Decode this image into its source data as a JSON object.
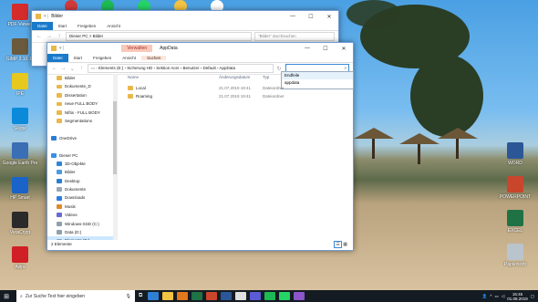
{
  "desktop": {
    "left_icons": [
      {
        "label": "PDF-Viewer",
        "color": "#d42b2b"
      },
      {
        "label": "GIMP 2.10.12",
        "color": "#6b5a3c"
      },
      {
        "label": "IPE",
        "color": "#e6c81e"
      },
      {
        "label": "Skype",
        "color": "#0b8ad9"
      },
      {
        "label": "Google Earth Pro",
        "color": "#3a6fb5"
      },
      {
        "label": "HP Smart",
        "color": "#1a63c8"
      },
      {
        "label": "VeraCrypt",
        "color": "#2a2a2a"
      },
      {
        "label": "Avira",
        "color": "#d11f26"
      }
    ],
    "right_icons": [
      {
        "label": "WORD",
        "color": "#2b5797"
      },
      {
        "label": "POWERPOINT",
        "color": "#c9462c"
      },
      {
        "label": "EXCEL",
        "color": "#1f7244"
      },
      {
        "label": "Papierkorb",
        "color": "#b9c4cc"
      }
    ],
    "top_icons": [
      {
        "color": "#d13b3b"
      },
      {
        "color": "#1db954"
      },
      {
        "color": "#25d366"
      },
      {
        "color": "#f3c342"
      },
      {
        "color": "#ffffff"
      }
    ]
  },
  "back_window": {
    "title": "Bilder",
    "tabs": [
      "Datei",
      "Start",
      "Freigeben",
      "Ansicht"
    ],
    "address": "Dieser PC  >  Bilder",
    "search_placeholder": "\"Bilder\" durchsuchen"
  },
  "front_window": {
    "title": "AppData",
    "context_tab": "Verwalten",
    "tabs": [
      "Datei",
      "Start",
      "Freigeben",
      "Ansicht",
      "Suchen"
    ],
    "address_parts": [
      "Elements (E:)",
      "Sicherung HD",
      "Sektion Acer",
      "Benutzer",
      "Default",
      "AppData"
    ],
    "search_value": "",
    "search_suggestions": [
      "Endfeile",
      "appdata"
    ],
    "columns": [
      "Name",
      "Änderungsdatum",
      "Typ"
    ],
    "files": [
      {
        "name": "Local",
        "date": "21.07.2019 19:41",
        "type": "Dateiordner"
      },
      {
        "name": "Roaming",
        "date": "21.07.2019 19:41",
        "type": "Dateiordner"
      }
    ],
    "nav_tree": [
      {
        "label": "Bilder",
        "icon": "folder",
        "indent": 1
      },
      {
        "label": "Dokumente_D",
        "icon": "folder",
        "indent": 1
      },
      {
        "label": "Dissertation",
        "icon": "folder",
        "indent": 1
      },
      {
        "label": "neue FULL BODY",
        "icon": "folder",
        "indent": 1
      },
      {
        "label": "Niftis - FULL BODY",
        "icon": "folder",
        "indent": 1
      },
      {
        "label": "Segmentations",
        "icon": "folder",
        "indent": 1
      },
      {
        "label": "",
        "icon": "none",
        "indent": 0
      },
      {
        "label": "OneDrive",
        "icon": "cloud",
        "indent": 0
      },
      {
        "label": "",
        "icon": "none",
        "indent": 0
      },
      {
        "label": "Dieser PC",
        "icon": "pc",
        "indent": 0
      },
      {
        "label": "3D-Objekte",
        "icon": "cube",
        "indent": 1
      },
      {
        "label": "Bilder",
        "icon": "pictures",
        "indent": 1
      },
      {
        "label": "Desktop",
        "icon": "desktop",
        "indent": 1
      },
      {
        "label": "Dokumente",
        "icon": "docs",
        "indent": 1
      },
      {
        "label": "Downloads",
        "icon": "download",
        "indent": 1
      },
      {
        "label": "Musik",
        "icon": "music",
        "indent": 1
      },
      {
        "label": "Videos",
        "icon": "video",
        "indent": 1
      },
      {
        "label": "Windows-SSD (C:)",
        "icon": "drive",
        "indent": 1
      },
      {
        "label": "Data (D:)",
        "icon": "drive",
        "indent": 1
      },
      {
        "label": "Elements (E:)",
        "icon": "drive",
        "indent": 1,
        "selected": true
      },
      {
        "label": "",
        "icon": "none",
        "indent": 0
      },
      {
        "label": "Elements (E:)",
        "icon": "drive",
        "indent": 0
      }
    ],
    "status": "2 Elemente"
  },
  "taskbar": {
    "search_placeholder": "Zur Suche Text hier eingeben",
    "time": "15:45",
    "date": "01.08.2019",
    "apps": [
      "#2f7fd2",
      "#f3c342",
      "#e0781c",
      "#1f7244",
      "#c9462c",
      "#2b5797",
      "#e0e0e0",
      "#5b5bd6",
      "#1db954",
      "#25d366",
      "#8a56c8"
    ]
  }
}
